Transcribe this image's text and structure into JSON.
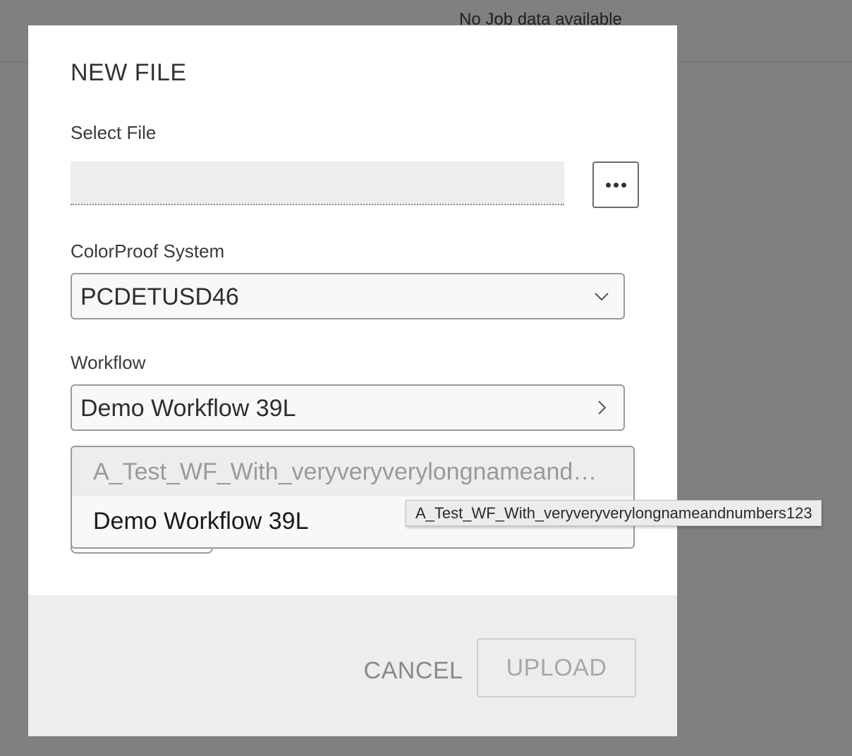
{
  "background": {
    "empty_text": "No Job data available"
  },
  "dialog": {
    "title": "NEW FILE",
    "select_file": {
      "label": "Select File",
      "value": "",
      "browse_icon": "ellipsis-icon"
    },
    "colorproof_system": {
      "label": "ColorProof System",
      "value": "PCDETUSD46",
      "icon": "chevron-down-icon"
    },
    "workflow": {
      "label": "Workflow",
      "value": "Demo Workflow 39L",
      "icon": "chevron-right-icon",
      "options": [
        {
          "label": "A_Test_WF_With_veryveryverylongnameandnumbers123",
          "disabled": true
        },
        {
          "label": "Demo Workflow 39L",
          "disabled": false
        }
      ],
      "tooltip": "A_Test_WF_With_veryveryverylongnameandnumbers123"
    },
    "footer": {
      "cancel_label": "CANCEL",
      "upload_label": "UPLOAD",
      "upload_enabled": false
    }
  },
  "colors": {
    "overlay": "#808080",
    "dialog_bg": "#ffffff",
    "footer_bg": "#ededed",
    "disabled_text": "#a8a8a8"
  }
}
